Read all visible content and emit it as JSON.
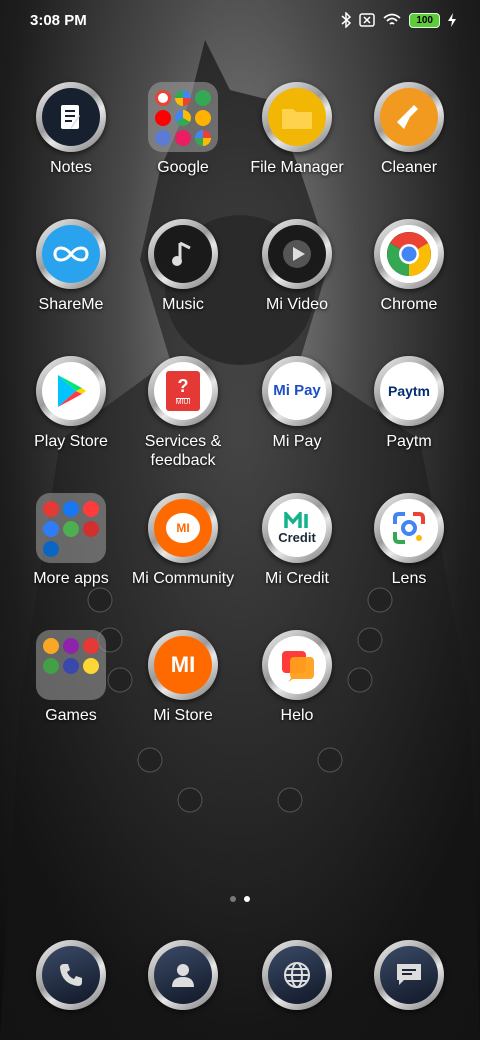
{
  "status_bar": {
    "time": "3:08 PM",
    "battery": "100",
    "icons": [
      "bluetooth-icon",
      "sim-off-icon",
      "wifi-icon",
      "battery-icon",
      "charging-icon"
    ]
  },
  "apps": {
    "row1": [
      {
        "label": "Notes",
        "icon": "notes-icon"
      },
      {
        "label": "Google",
        "icon": "google-folder"
      },
      {
        "label": "File Manager",
        "icon": "folder-icon"
      },
      {
        "label": "Cleaner",
        "icon": "broom-icon"
      }
    ],
    "row2": [
      {
        "label": "ShareMe",
        "icon": "infinity-icon"
      },
      {
        "label": "Music",
        "icon": "music-note-icon"
      },
      {
        "label": "Mi Video",
        "icon": "play-icon"
      },
      {
        "label": "Chrome",
        "icon": "chrome-icon"
      }
    ],
    "row3": [
      {
        "label": "Play Store",
        "icon": "play-store-icon"
      },
      {
        "label": "Services & feedback",
        "icon": "services-icon",
        "badge": "MIUI"
      },
      {
        "label": "Mi Pay",
        "icon": "mi-pay-icon",
        "text": "Mi Pay"
      },
      {
        "label": "Paytm",
        "icon": "paytm-icon",
        "text": "Paytm"
      }
    ],
    "row4": [
      {
        "label": "More apps",
        "icon": "more-apps-folder"
      },
      {
        "label": "Mi Community",
        "icon": "mi-community-icon",
        "text": "MI"
      },
      {
        "label": "Mi Credit",
        "icon": "mi-credit-icon",
        "text": "Credit"
      },
      {
        "label": "Lens",
        "icon": "lens-icon"
      }
    ],
    "row5": [
      {
        "label": "Games",
        "icon": "games-folder"
      },
      {
        "label": "Mi Store",
        "icon": "mi-store-icon",
        "text": "MI"
      },
      {
        "label": "Helo",
        "icon": "helo-icon"
      }
    ]
  },
  "page_indicator": {
    "count": 2,
    "active": 2
  },
  "dock": [
    {
      "name": "phone",
      "icon": "phone-icon"
    },
    {
      "name": "contacts",
      "icon": "contacts-icon"
    },
    {
      "name": "browser",
      "icon": "globe-icon"
    },
    {
      "name": "messages",
      "icon": "message-icon"
    }
  ],
  "colors": {
    "battery": "#5ecb3b",
    "file_manager": "#f2b705",
    "cleaner": "#f29a1f",
    "shareme": "#29a3ee",
    "mi_orange": "#ff6a00"
  }
}
